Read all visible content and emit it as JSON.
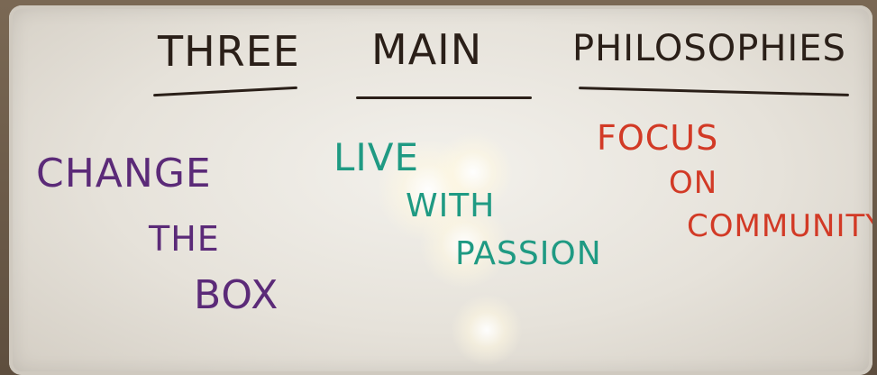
{
  "title": {
    "word1": "THREE",
    "word2": "MAIN",
    "word3": "PHILOSOPHIES"
  },
  "philosophies": [
    {
      "lines": [
        "CHANGE",
        "THE",
        "BOX"
      ],
      "color": "#5b2a78"
    },
    {
      "lines": [
        "LIVE",
        "WITH",
        "PASSION"
      ],
      "color": "#1f9a83"
    },
    {
      "lines": [
        "FOCUS",
        "ON",
        "COMMUNITY"
      ],
      "color": "#d23a26"
    }
  ],
  "colors": {
    "board": "#ecE8e1",
    "title_ink": "#2a1f18"
  }
}
